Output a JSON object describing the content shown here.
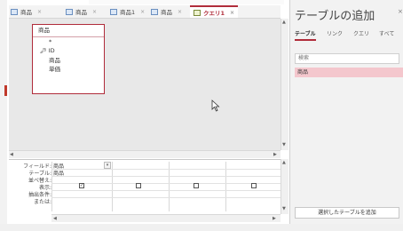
{
  "tabs": [
    {
      "label": "商品",
      "icon": "table-icon"
    },
    {
      "label": "商品",
      "icon": "table-icon"
    },
    {
      "label": "商品1",
      "icon": "table-icon"
    },
    {
      "label": "商品",
      "icon": "table-icon"
    },
    {
      "label": "クエリ1",
      "icon": "query-icon",
      "active": true
    }
  ],
  "table_box": {
    "title": "商品",
    "fields": [
      "*",
      "ID",
      "商品",
      "単価"
    ]
  },
  "grid": {
    "row_labels": [
      "フィールド:",
      "テーブル:",
      "並べ替え:",
      "表示:",
      "抽出条件:",
      "または:"
    ],
    "col1_field": "商品",
    "col1_table": "商品",
    "show_checked": [
      true,
      false,
      false,
      false
    ]
  },
  "pane": {
    "title": "テーブルの追加",
    "close": "×",
    "tabs": [
      "テーブル",
      "リンク",
      "クエリ",
      "すべて"
    ],
    "search_placeholder": "検索",
    "list_items": [
      "商品"
    ],
    "add_button": "選択したテーブルを追加"
  },
  "colors": {
    "accent": "#b02c3a",
    "selection": "#f4c7cd",
    "design_bg": "#e8e8e8"
  }
}
